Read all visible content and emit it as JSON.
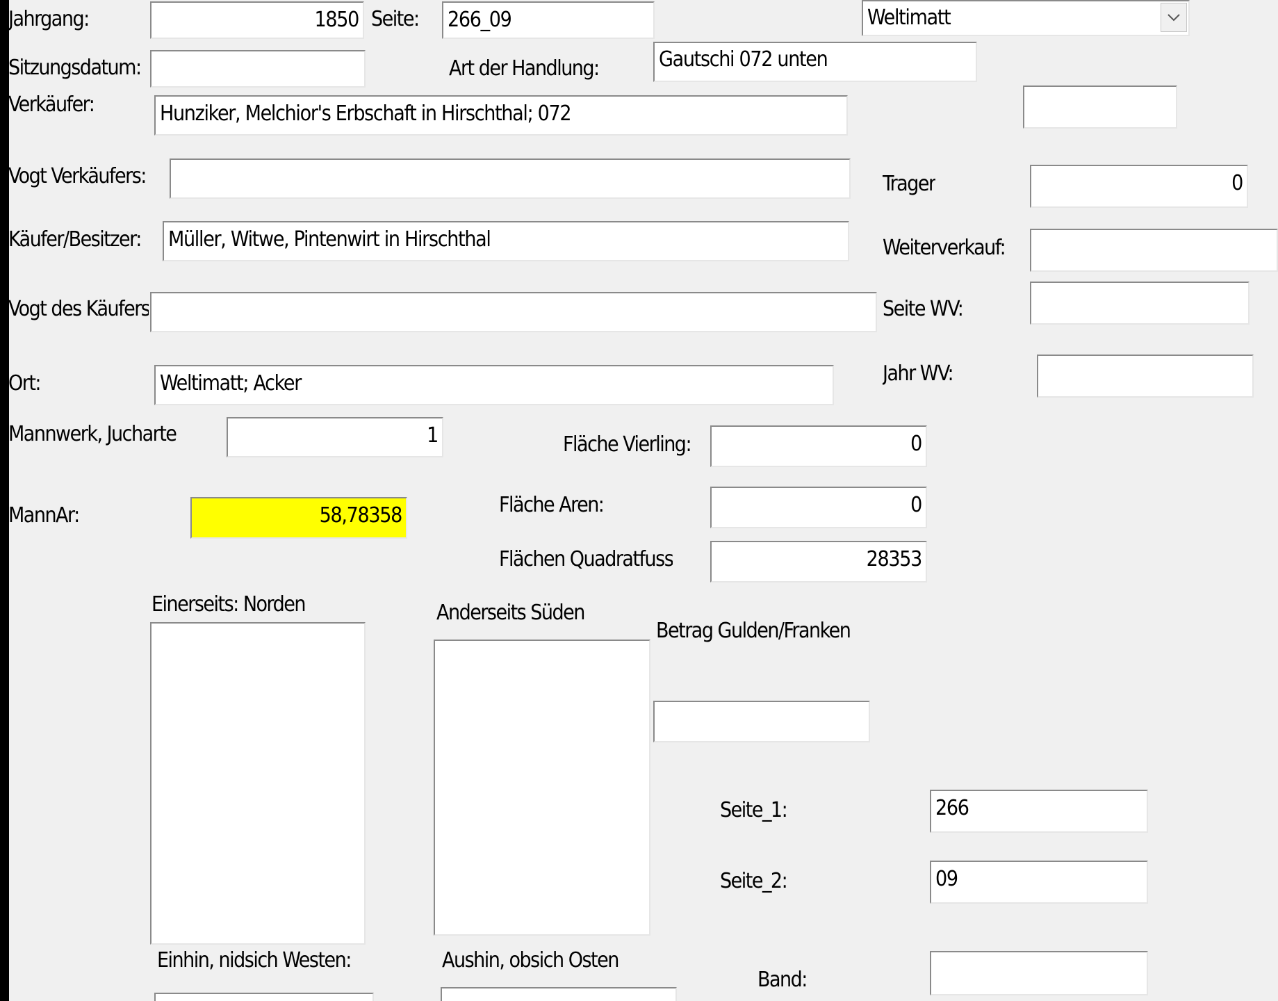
{
  "form": {
    "jahrgang": {
      "label": "Jahrgang:",
      "value": "1850"
    },
    "seite": {
      "label": "Seite:",
      "value": "266_09"
    },
    "ort_combo": {
      "value": "Weltimatt"
    },
    "sitzungsdatum": {
      "label": "Sitzungsdatum:",
      "value": ""
    },
    "art_der_handlung": {
      "label": "Art der Handlung:",
      "value": "Gautschi 072 unten"
    },
    "verkaeufer": {
      "label": "Verkäufer:",
      "value": "Hunziker, Melchior's Erbschaft in Hirschthal; 072"
    },
    "extra_field": {
      "value": ""
    },
    "vogt_verkaeufers": {
      "label": "Vogt Verkäufers:",
      "value": ""
    },
    "trager": {
      "label": "Trager",
      "value": "0"
    },
    "kaeufer_besitzer": {
      "label": "Käufer/Besitzer:",
      "value": "Müller, Witwe, Pintenwirt in Hirschthal"
    },
    "weiterverkauf": {
      "label": "Weiterverkauf:",
      "value": ""
    },
    "vogt_des_kaeufers": {
      "label": "Vogt des Käufers",
      "value": ""
    },
    "seite_wv": {
      "label": "Seite WV:",
      "value": ""
    },
    "ort": {
      "label": "Ort:",
      "value": "Weltimatt; Acker"
    },
    "jahr_wv": {
      "label": "Jahr WV:",
      "value": ""
    },
    "mannwerk_jucharte": {
      "label": "Mannwerk, Jucharte",
      "value": "1"
    },
    "flaeche_vierling": {
      "label": "Fläche Vierling:",
      "value": "0"
    },
    "mannar": {
      "label": "MannAr:",
      "value": "58,78358"
    },
    "flaeche_aren": {
      "label": "Fläche Aren:",
      "value": "0"
    },
    "flaechen_quadratfuss": {
      "label": "Flächen Quadratfuss",
      "value": "28353"
    },
    "einerseits_norden": {
      "label": "Einerseits: Norden",
      "value": ""
    },
    "anderseits_sueden": {
      "label": "Anderseits Süden",
      "value": ""
    },
    "betrag": {
      "label": "Betrag Gulden/Franken",
      "value": ""
    },
    "seite_1": {
      "label": "Seite_1:",
      "value": "266"
    },
    "seite_2": {
      "label": "Seite_2:",
      "value": "09"
    },
    "einhin_westen": {
      "label": "Einhin, nidsich Westen:",
      "value": ""
    },
    "aushin_osten": {
      "label": "Aushin,  obsich Osten",
      "value": ""
    },
    "band": {
      "label": "Band:",
      "value": ""
    }
  },
  "colors": {
    "highlight": "#ffff00",
    "background": "#f0f0f0"
  },
  "icons": {
    "combo_dropdown": "chevron-down-icon"
  }
}
